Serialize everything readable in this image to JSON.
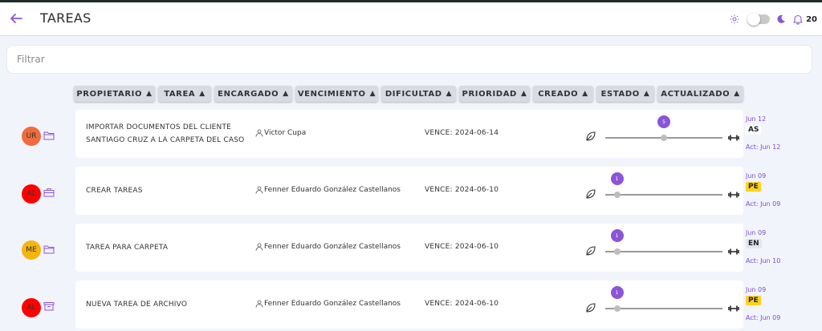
{
  "header": {
    "title": "TAREAS",
    "notifications": "20",
    "accent": "#8b55d6",
    "icons": [
      "back-arrow-icon",
      "sun-icon",
      "theme-toggle",
      "moon-icon",
      "bell-icon"
    ]
  },
  "filter": {
    "placeholder": "Filtrar",
    "value": ""
  },
  "columns": [
    "PROPIETARIO",
    "TAREA",
    "ENCARGADO",
    "VENCIMIENTO",
    "DIFICULTAD",
    "PRIORIDAD",
    "CREADO",
    "ESTADO",
    "ACTUALIZADO"
  ],
  "tasks": [
    {
      "initials": "UR",
      "avatar_color": "#f26b3a",
      "icon": "folder-icon",
      "title_line1": "IMPORTAR DOCUMENTOS DEL CLIENTE",
      "title_line2": "SANTIAGO CRUZ A LA CARPETA DEL CASO",
      "assignee": "Victor Cupa",
      "due": "VENCE: 2024-06-14",
      "difficulty": "5",
      "difficulty_fraction": 0.5,
      "created": "Jun 12",
      "status": "AS",
      "status_color": "#ffffff",
      "updated": "Act: Jun 12"
    },
    {
      "initials": "AL",
      "avatar_color": "#ff0000",
      "icon": "briefcase-icon",
      "title_line1": "CREAR TAREAS",
      "title_line2": "",
      "assignee": "Fenner Eduardo González Castellanos",
      "due": "VENCE: 2024-06-10",
      "difficulty": "1",
      "difficulty_fraction": 0.1,
      "created": "Jun 09",
      "status": "PE",
      "status_color": "#ffd21f",
      "updated": "Act: Jun 09"
    },
    {
      "initials": "ME",
      "avatar_color": "#f5b50a",
      "icon": "folder-icon",
      "title_line1": "TAREA PARA CARPETA",
      "title_line2": "",
      "assignee": "Fenner Eduardo González Castellanos",
      "due": "VENCE: 2024-06-10",
      "difficulty": "1",
      "difficulty_fraction": 0.1,
      "created": "Jun 09",
      "status": "EN",
      "status_color": "#e3e6ee",
      "updated": "Act: Jun 10"
    },
    {
      "initials": "AL",
      "avatar_color": "#ff0000",
      "icon": "archive-icon",
      "title_line1": "NUEVA TAREA DE ARCHIVO",
      "title_line2": "",
      "assignee": "Fenner Eduardo González Castellanos",
      "due": "VENCE: 2024-06-10",
      "difficulty": "1",
      "difficulty_fraction": 0.1,
      "created": "Jun 09",
      "status": "PE",
      "status_color": "#ffd21f",
      "updated": "Act: Jun 09"
    }
  ]
}
